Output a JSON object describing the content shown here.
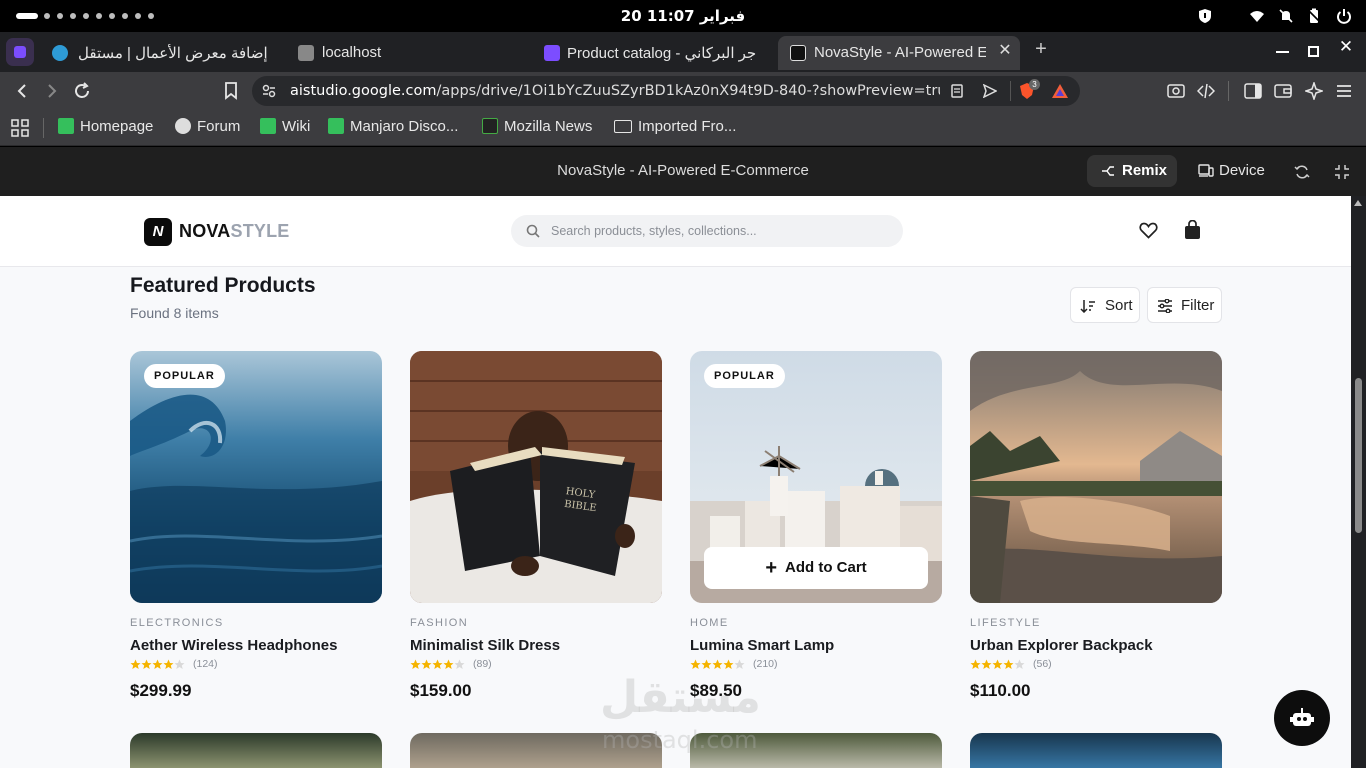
{
  "system": {
    "clock": "20 فبراير 11:07",
    "icons": [
      "shield-icon",
      "wifi-icon",
      "bell-off-icon",
      "battery-icon",
      "power-icon"
    ]
  },
  "tabs": [
    {
      "label": "إضافة معرض الأعمال | مستقل",
      "icon": "mostaql-icon"
    },
    {
      "label": "localhost",
      "icon": "localhost-icon"
    },
    {
      "label": "Product catalog - جر البركاني",
      "icon": "mostaql-icon"
    },
    {
      "label": "NovaStyle - AI-Powered E",
      "icon": "aistudio-icon",
      "active": true
    }
  ],
  "address_bar": {
    "host": "aistudio.google.com",
    "path": "/apps/drive/1Oi1bYcZuuSZyrBD1kAz0nX94t9D-840-?showPreview=true&sh...",
    "shield_count": "3"
  },
  "bookmarks": [
    {
      "label": "Homepage",
      "color": "#35bf5c"
    },
    {
      "label": "Forum",
      "color": "#dddddd"
    },
    {
      "label": "Wiki",
      "color": "#35bf5c"
    },
    {
      "label": "Manjaro Disco...",
      "color": "#35bf5c"
    },
    {
      "label": "Mozilla News",
      "color": "#222222"
    },
    {
      "label": "Imported Fro...",
      "color": "folder"
    }
  ],
  "studio": {
    "title": "NovaStyle - AI-Powered E-Commerce",
    "remix_label": "Remix",
    "device_label": "Device"
  },
  "app": {
    "logo_mark": "N",
    "logo_bold": "NOVA",
    "logo_light": "STYLE",
    "search_placeholder": "Search products, styles, collections...",
    "section_title": "Featured Products",
    "count_text": "Found 8 items",
    "sort_label": "Sort",
    "filter_label": "Filter",
    "add_to_cart_label": "Add to Cart",
    "products": [
      {
        "badge": "POPULAR",
        "category": "ELECTRONICS",
        "name": "Aether Wireless Headphones",
        "rating": 4.5,
        "reviews": "(124)",
        "price": "$299.99"
      },
      {
        "badge": "",
        "category": "FASHION",
        "name": "Minimalist Silk Dress",
        "rating": 4.5,
        "reviews": "(89)",
        "price": "$159.00"
      },
      {
        "badge": "POPULAR",
        "category": "HOME",
        "name": "Lumina Smart Lamp",
        "rating": 4.5,
        "reviews": "(210)",
        "price": "$89.50"
      },
      {
        "badge": "",
        "category": "LIFESTYLE",
        "name": "Urban Explorer Backpack",
        "rating": 4.5,
        "reviews": "(56)",
        "price": "$110.00"
      }
    ],
    "watermark_ar": "مستقل",
    "watermark_en": "mostaql.com"
  }
}
